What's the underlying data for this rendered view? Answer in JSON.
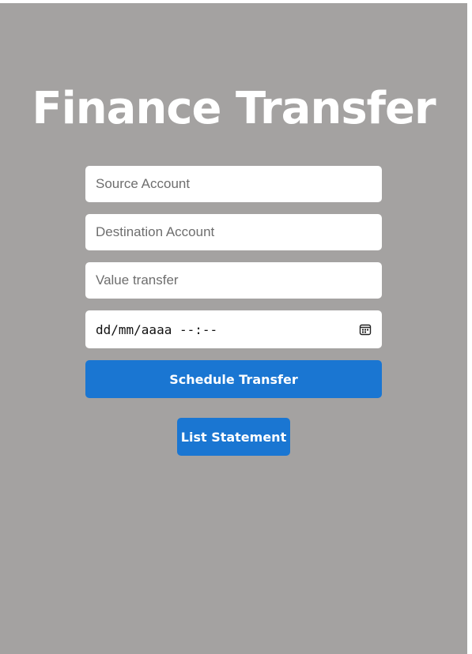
{
  "page": {
    "title": "Finance Transfer",
    "background_color": "#a4a2a1",
    "accent_color": "#1a76d2"
  },
  "form": {
    "source_account": {
      "placeholder": "Source Account",
      "value": ""
    },
    "destination_account": {
      "placeholder": "Destination Account",
      "value": ""
    },
    "value_transfer": {
      "placeholder": "Value transfer",
      "value": ""
    },
    "datetime": {
      "display": "dd/mm/aaaa --:--",
      "icon": "calendar-icon"
    },
    "schedule_button": "Schedule Transfer"
  },
  "list_button": "List Statement"
}
